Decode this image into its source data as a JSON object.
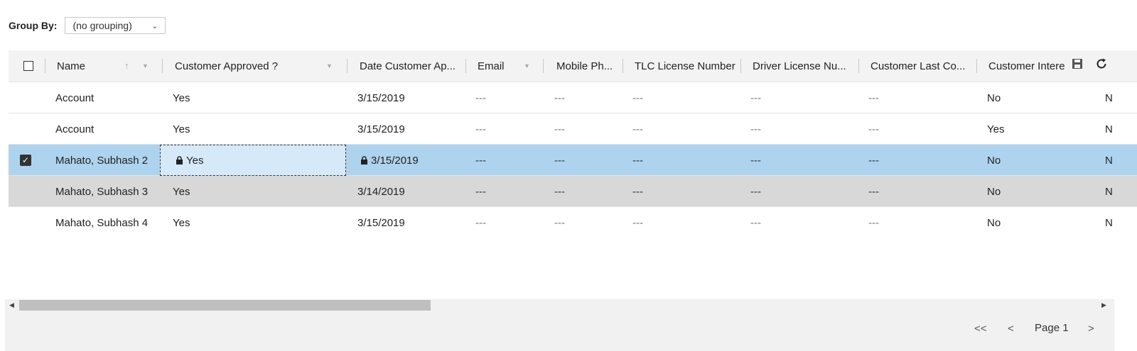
{
  "group_by": {
    "label": "Group By:",
    "value": "(no grouping)"
  },
  "columns": [
    {
      "label": "Name",
      "sort": "asc"
    },
    {
      "label": "Customer Approved ?"
    },
    {
      "label": "Date Customer Ap..."
    },
    {
      "label": "Email"
    },
    {
      "label": "Mobile Ph..."
    },
    {
      "label": "TLC License Number"
    },
    {
      "label": "Driver License Nu..."
    },
    {
      "label": "Customer Last Co..."
    },
    {
      "label": "Customer Intere"
    }
  ],
  "rows": [
    {
      "name": "Account",
      "approved": "Yes",
      "date": "3/15/2019",
      "email": "---",
      "mobile": "---",
      "tlc": "---",
      "driver": "---",
      "last_contact": "---",
      "interest": "No",
      "next": "N",
      "state": "normal"
    },
    {
      "name": "Account",
      "approved": "Yes",
      "date": "3/15/2019",
      "email": "---",
      "mobile": "---",
      "tlc": "---",
      "driver": "---",
      "last_contact": "---",
      "interest": "Yes",
      "next": "N",
      "state": "normal"
    },
    {
      "name": "Mahato, Subhash 2",
      "approved": "Yes",
      "date": "3/15/2019",
      "email": "---",
      "mobile": "---",
      "tlc": "---",
      "driver": "---",
      "last_contact": "---",
      "interest": "No",
      "next": "N",
      "state": "selected"
    },
    {
      "name": "Mahato, Subhash 3",
      "approved": "Yes",
      "date": "3/14/2019",
      "email": "---",
      "mobile": "---",
      "tlc": "---",
      "driver": "---",
      "last_contact": "---",
      "interest": "No",
      "next": "N",
      "state": "hover"
    },
    {
      "name": "Mahato, Subhash 4",
      "approved": "Yes",
      "date": "3/15/2019",
      "email": "---",
      "mobile": "---",
      "tlc": "---",
      "driver": "---",
      "last_contact": "---",
      "interest": "No",
      "next": "N",
      "state": "normal"
    }
  ],
  "toolbar": {
    "save_icon": "save-icon",
    "refresh_icon": "refresh-icon"
  },
  "pagination": {
    "first": "<<",
    "prev": "<",
    "page_label": "Page 1",
    "next": ">"
  },
  "colors": {
    "selected_row": "#aed3ee",
    "hover_row": "#d8d8d8",
    "edit_cell": "#d6e9f8"
  }
}
